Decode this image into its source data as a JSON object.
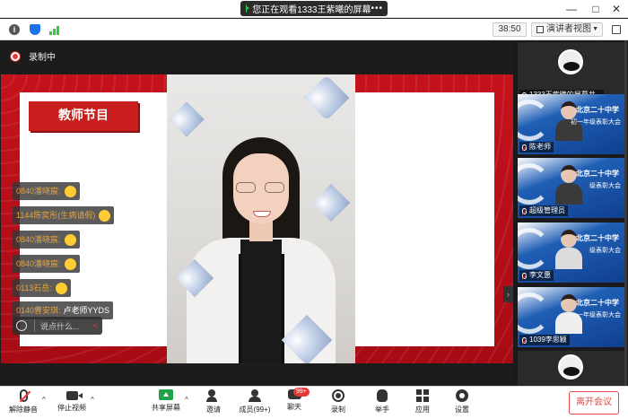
{
  "titlebar": {
    "share_status": "您正在观看1333王紫曦的屏幕",
    "more": "•••",
    "minimize": "—",
    "maximize": "□",
    "close": "✕"
  },
  "toolbar": {
    "timer": "38:50",
    "view_mode": "演讲者视图",
    "view_caret": "▼"
  },
  "recording": {
    "label": "录制中"
  },
  "slide": {
    "title": "教师节目"
  },
  "chat": {
    "messages": [
      {
        "sender": "0840潘晓宸:",
        "text": "",
        "emoji": "clap-emoji"
      },
      {
        "sender": "1144陈奕彤(生病请假)",
        "text": "",
        "emoji": "thumbs-up-emoji"
      },
      {
        "sender": "0840潘晓宸:",
        "text": "",
        "emoji": "clap-emoji"
      },
      {
        "sender": "0840潘晓宸:",
        "text": "",
        "emoji": "thumbs-up-emoji"
      },
      {
        "sender": "0113石岳:",
        "text": "",
        "emoji": "grin-emoji"
      },
      {
        "sender": "0140曹安琪:",
        "text": "卢老师YYDS",
        "emoji": ""
      }
    ],
    "input_placeholder": "说点什么...",
    "send_icon": "<"
  },
  "participants": [
    {
      "name": "1333王紫曦的屏幕共...",
      "type": "avatar"
    },
    {
      "name": "陈老师",
      "banner": "北京二十中学",
      "sub": "初一年级表彰大会"
    },
    {
      "name": "超级管理员",
      "banner": "北京二十中学",
      "sub": "级表彰大会"
    },
    {
      "name": "李文惠",
      "banner": "北京二十中学",
      "sub": "级表彰大会"
    },
    {
      "name": "1039李思颖",
      "banner": "北京二十中学",
      "sub": "一年级表彰大会"
    }
  ],
  "bottom": {
    "mute": "解除静音",
    "video": "停止视频",
    "share": "共享屏幕",
    "invite": "邀请",
    "members": "成员(99+)",
    "chat": "聊天",
    "chat_badge": "99+",
    "record": "录制",
    "raise_hand": "举手",
    "apps": "应用",
    "settings": "设置",
    "leave": "离开会议",
    "caret": "^"
  },
  "colors": {
    "slide_red": "#c5121d",
    "chat_orange": "#e8a238",
    "leave_red": "#e24a4a",
    "share_green": "#1fa34a"
  }
}
